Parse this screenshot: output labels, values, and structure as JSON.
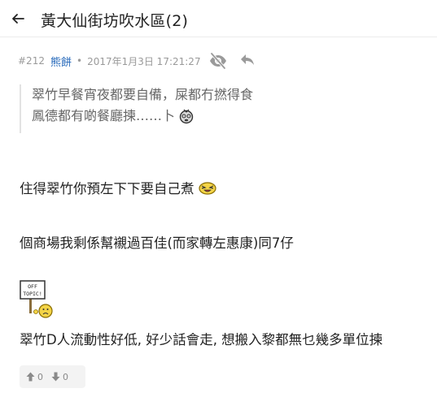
{
  "header": {
    "title": "黃大仙街坊吹水區(2)"
  },
  "post": {
    "number": "#212",
    "author": "熊餅",
    "separator": "•",
    "timestamp": "2017年1月3日 17:21:27",
    "quote": {
      "line1": "翠竹早餐宵夜都要自備，屎都冇撚得食",
      "line2": "鳳德都有啲餐廳揀……卜"
    },
    "paragraphs": [
      "住得翠竹你預左下下要自己煮",
      "個商場我剩係幫襯過百佳(而家轉左惠康)同7仔",
      "翠竹D人流動性好低, 好少話會走, 想搬入黎都無乜幾多單位揀"
    ],
    "sticker": {
      "text_line1": "OFF",
      "text_line2": "TOPIC!"
    },
    "votes": {
      "up_count": "0",
      "down_count": "0"
    }
  },
  "colors": {
    "author": "#1f64b8",
    "meta": "#9a9a9a",
    "quote_text": "#666666",
    "quote_border": "#e2e2e2",
    "vote_bg": "#f3f3f3"
  },
  "icons": {
    "back": "arrow-left-icon",
    "hide": "eye-slash-icon",
    "reply": "reply-icon",
    "upvote": "arrow-up-icon",
    "downvote": "arrow-down-icon"
  }
}
